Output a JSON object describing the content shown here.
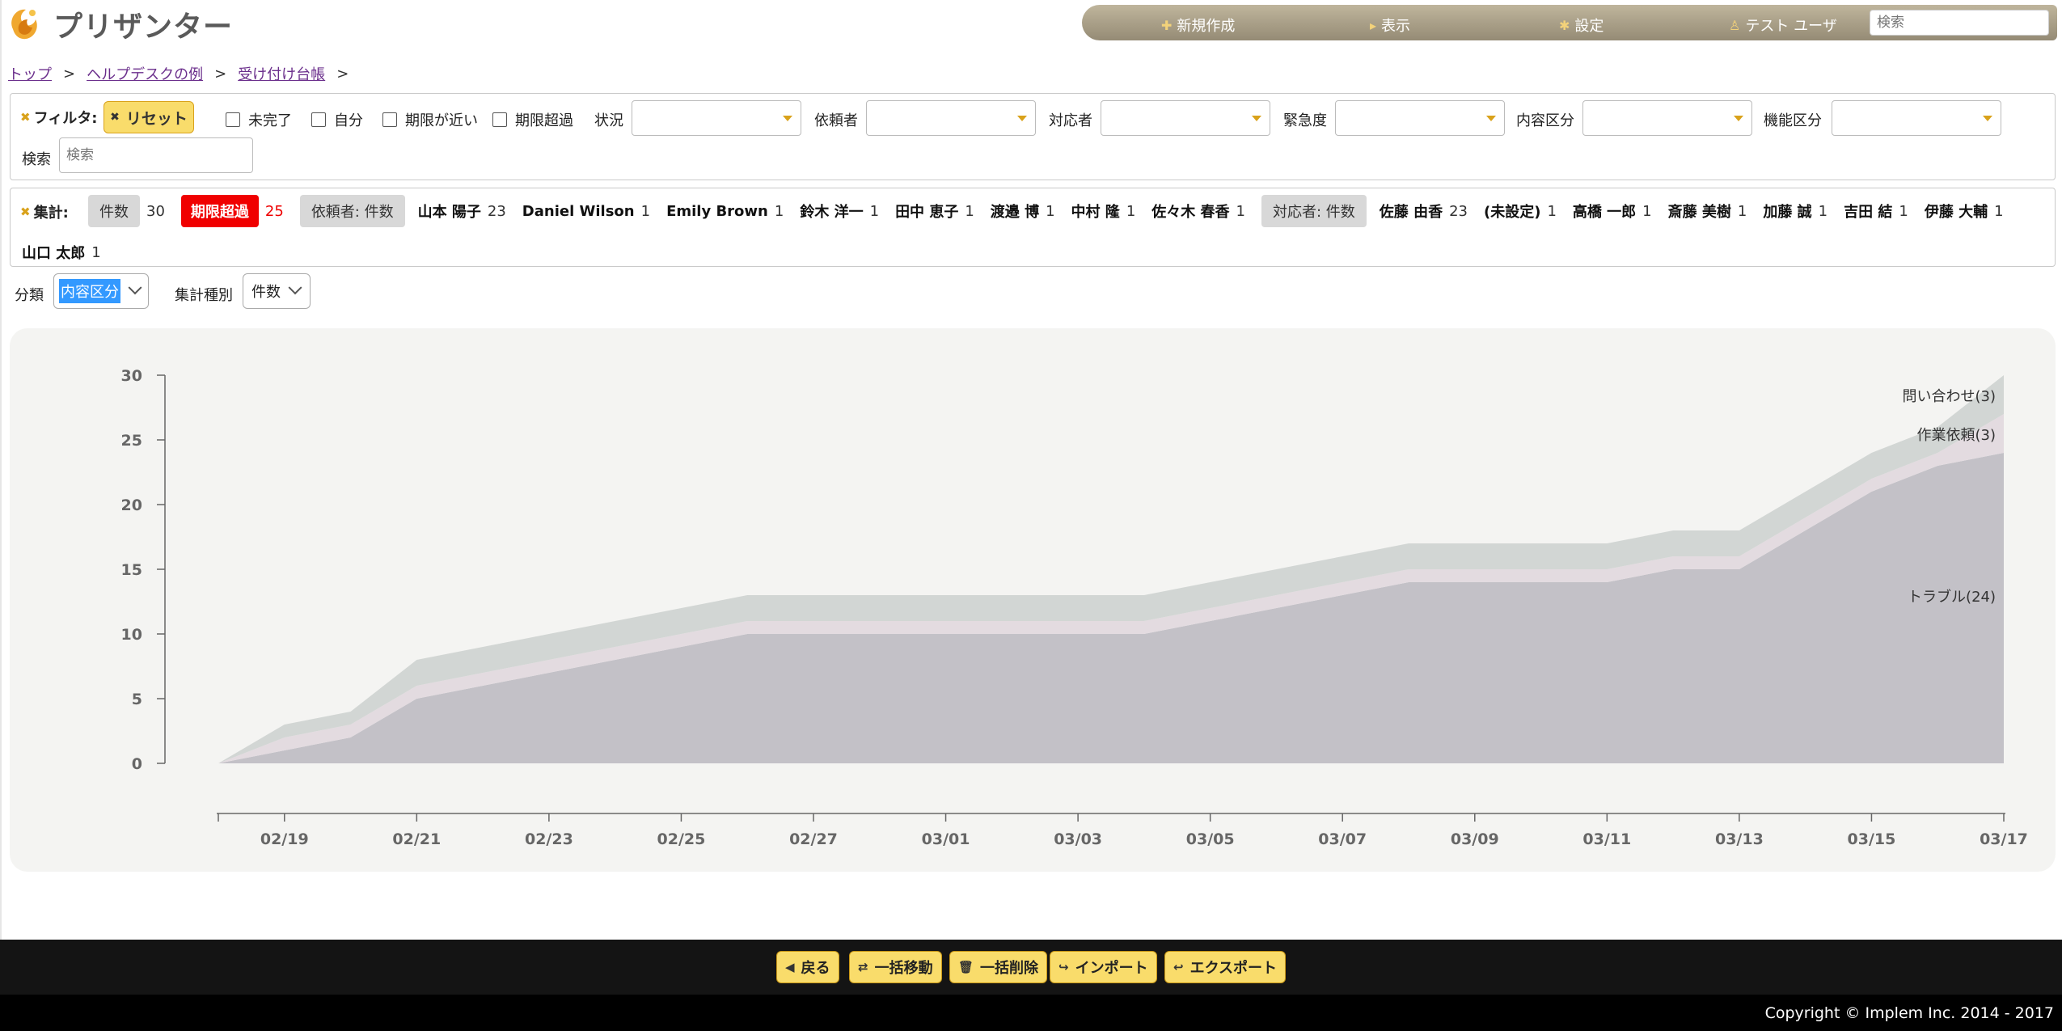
{
  "app": {
    "logo_text": "プリザンター"
  },
  "topnav": {
    "new": "新規作成",
    "view": "表示",
    "settings": "設定",
    "user": "テスト ユーザ",
    "search_placeholder": "検索"
  },
  "breadcrumb": {
    "items": [
      "トップ",
      "ヘルプデスクの例",
      "受け付け台帳"
    ],
    "sep": ">"
  },
  "filter": {
    "label": "フィルタ:",
    "reset": "リセット",
    "checks": [
      "未完了",
      "自分",
      "期限が近い",
      "期限超過"
    ],
    "selects": [
      "状況",
      "依頼者",
      "対応者",
      "緊急度",
      "内容区分",
      "機能区分"
    ],
    "search_label": "検索",
    "search_placeholder": "検索"
  },
  "summary": {
    "label": "集計:",
    "count_label": "件数",
    "count": "30",
    "overdue_label": "期限超過",
    "overdue": "25",
    "requester_label": "依頼者: 件数",
    "requesters": [
      {
        "name": "山本 陽子",
        "count": "23"
      },
      {
        "name": "Daniel Wilson",
        "count": "1"
      },
      {
        "name": "Emily Brown",
        "count": "1"
      },
      {
        "name": "鈴木 洋一",
        "count": "1"
      },
      {
        "name": "田中 恵子",
        "count": "1"
      },
      {
        "name": "渡邉 博",
        "count": "1"
      },
      {
        "name": "中村 隆",
        "count": "1"
      },
      {
        "name": "佐々木 春香",
        "count": "1"
      }
    ],
    "assignee_label": "対応者: 件数",
    "assignees": [
      {
        "name": "佐藤 由香",
        "count": "23"
      },
      {
        "name": "(未設定)",
        "count": "1"
      },
      {
        "name": "高橋 一郎",
        "count": "1"
      },
      {
        "name": "斎藤 美樹",
        "count": "1"
      },
      {
        "name": "加藤 誠",
        "count": "1"
      },
      {
        "name": "吉田 結",
        "count": "1"
      },
      {
        "name": "伊藤 大輔",
        "count": "1"
      },
      {
        "name": "山口 太郎",
        "count": "1"
      }
    ]
  },
  "options": {
    "category_label": "分類",
    "category_value": "内容区分",
    "agg_label": "集計種別",
    "agg_value": "件数"
  },
  "chart_data": {
    "type": "area",
    "stacked": true,
    "x": [
      "02/18",
      "02/19",
      "02/20",
      "02/21",
      "02/22",
      "02/23",
      "02/24",
      "02/25",
      "02/26",
      "02/27",
      "02/28",
      "03/01",
      "03/02",
      "03/03",
      "03/04",
      "03/05",
      "03/06",
      "03/07",
      "03/08",
      "03/09",
      "03/10",
      "03/11",
      "03/12",
      "03/13",
      "03/14",
      "03/15",
      "03/16",
      "03/17"
    ],
    "x_tick_labels": [
      "02/19",
      "02/21",
      "02/23",
      "02/25",
      "02/27",
      "03/01",
      "03/03",
      "03/05",
      "03/07",
      "03/09",
      "03/11",
      "03/13",
      "03/15",
      "03/17"
    ],
    "ylim": [
      0,
      30
    ],
    "yticks": [
      0,
      5,
      10,
      15,
      20,
      25,
      30
    ],
    "series": [
      {
        "name": "トラブル(24)",
        "color": "#c3c1c7",
        "values": [
          0,
          1,
          2,
          5,
          6,
          7,
          8,
          9,
          10,
          10,
          10,
          10,
          10,
          10,
          10,
          11,
          12,
          13,
          14,
          14,
          14,
          14,
          15,
          15,
          18,
          21,
          23,
          24
        ]
      },
      {
        "name": "作業依頼(3)",
        "color": "#e3dbe0",
        "values": [
          0,
          1,
          1,
          1,
          1,
          1,
          1,
          1,
          1,
          1,
          1,
          1,
          1,
          1,
          1,
          1,
          1,
          1,
          1,
          1,
          1,
          1,
          1,
          1,
          1,
          1,
          1,
          3
        ]
      },
      {
        "name": "問い合わせ(3)",
        "color": "#d2d6d4",
        "values": [
          0,
          1,
          1,
          2,
          2,
          2,
          2,
          2,
          2,
          2,
          2,
          2,
          2,
          2,
          2,
          2,
          2,
          2,
          2,
          2,
          2,
          2,
          2,
          2,
          2,
          2,
          2,
          3
        ]
      }
    ]
  },
  "toolbar": {
    "back": "戻る",
    "bulk_move": "一括移動",
    "bulk_delete": "一括削除",
    "import": "インポート",
    "export": "エクスポート"
  },
  "footer": {
    "copyright": "Copyright © Implem Inc. 2014 - 2017"
  }
}
